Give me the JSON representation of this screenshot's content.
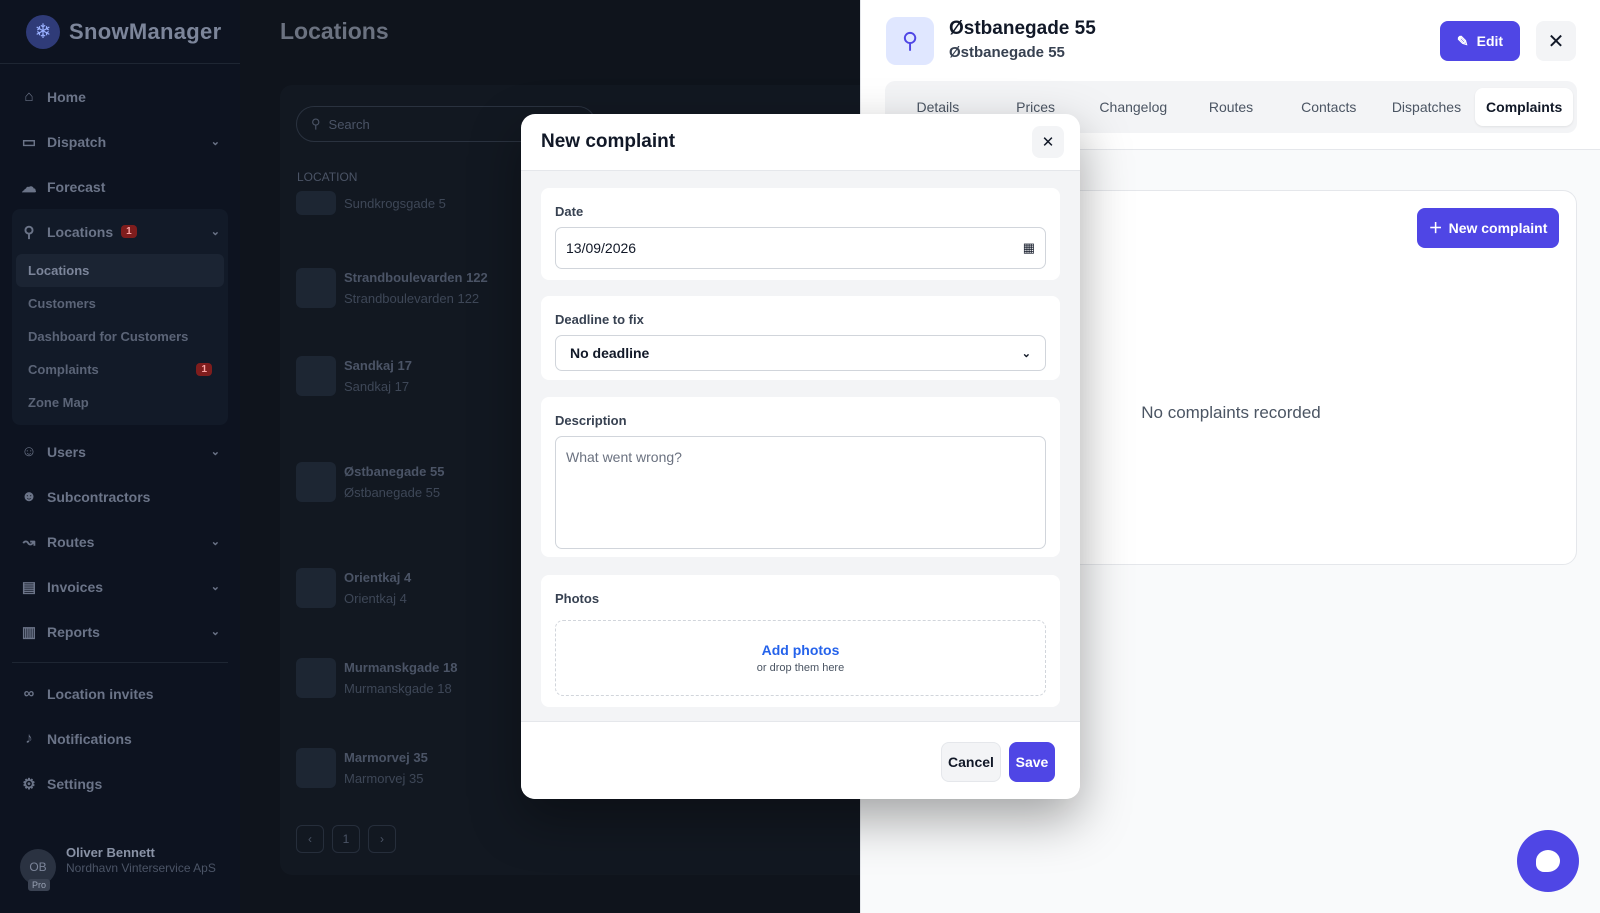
{
  "app": {
    "brand": "SnowManager"
  },
  "sidebar": {
    "items": [
      {
        "label": "Home",
        "icon": "home-icon"
      },
      {
        "label": "Dispatch",
        "icon": "truck-icon"
      },
      {
        "label": "Forecast",
        "icon": "cloud-icon"
      },
      {
        "label": "Locations",
        "icon": "location-pin-icon",
        "badge": "1"
      },
      {
        "label": "Users",
        "icon": "user-icon"
      },
      {
        "label": "Subcontractors",
        "icon": "users-icon"
      },
      {
        "label": "Routes",
        "icon": "route-icon"
      },
      {
        "label": "Invoices",
        "icon": "wallet-icon"
      },
      {
        "label": "Reports",
        "icon": "chart-icon"
      },
      {
        "label": "Location invites",
        "icon": "link-icon"
      },
      {
        "label": "Notifications",
        "icon": "bell-icon"
      },
      {
        "label": "Settings",
        "icon": "gear-icon"
      }
    ],
    "locations_sub": [
      {
        "label": "Locations"
      },
      {
        "label": "Customers"
      },
      {
        "label": "Dashboard for Customers"
      },
      {
        "label": "Complaints",
        "badge": "1"
      },
      {
        "label": "Zone Map"
      }
    ],
    "user": {
      "initials": "OB",
      "plan": "Pro",
      "name": "Oliver Bennett",
      "company": "Nordhavn Vinterservice ApS"
    }
  },
  "main": {
    "title": "Locations",
    "search_placeholder": "Search",
    "column_header": "LOCATION",
    "rows": [
      {
        "name": "",
        "address": "Sundkrogsgade 5"
      },
      {
        "name": "Strandboulevarden 122",
        "address": "Strandboulevarden 122"
      },
      {
        "name": "Sandkaj 17",
        "address": "Sandkaj 17"
      },
      {
        "name": "Østbanegade 55",
        "address": "Østbanegade 55"
      },
      {
        "name": "Orientkaj 4",
        "address": "Orientkaj 4"
      },
      {
        "name": "Murmanskgade 18",
        "address": "Murmanskgade 18"
      },
      {
        "name": "Marmorvej 35",
        "address": "Marmorvej 35"
      }
    ],
    "page": "1"
  },
  "panel": {
    "title": "Østbanegade 55",
    "subtitle": "Østbanegade 55",
    "edit_label": "Edit",
    "tabs": [
      "Details",
      "Prices",
      "Changelog",
      "Routes",
      "Contacts",
      "Dispatches",
      "Complaints"
    ],
    "active_tab": "Complaints",
    "new_complaint_label": "New complaint",
    "empty_text": "No complaints recorded"
  },
  "modal": {
    "title": "New complaint",
    "date_label": "Date",
    "date_value": "13/09/2026",
    "deadline_label": "Deadline to fix",
    "deadline_value": "No deadline",
    "description_label": "Description",
    "description_placeholder": "What went wrong?",
    "photos_label": "Photos",
    "add_photos": "Add photos",
    "drop_hint": "or drop them here",
    "cancel": "Cancel",
    "save": "Save"
  },
  "colors": {
    "accent": "#4f46e5",
    "link": "#2563eb",
    "badge": "#7f1d1d"
  }
}
